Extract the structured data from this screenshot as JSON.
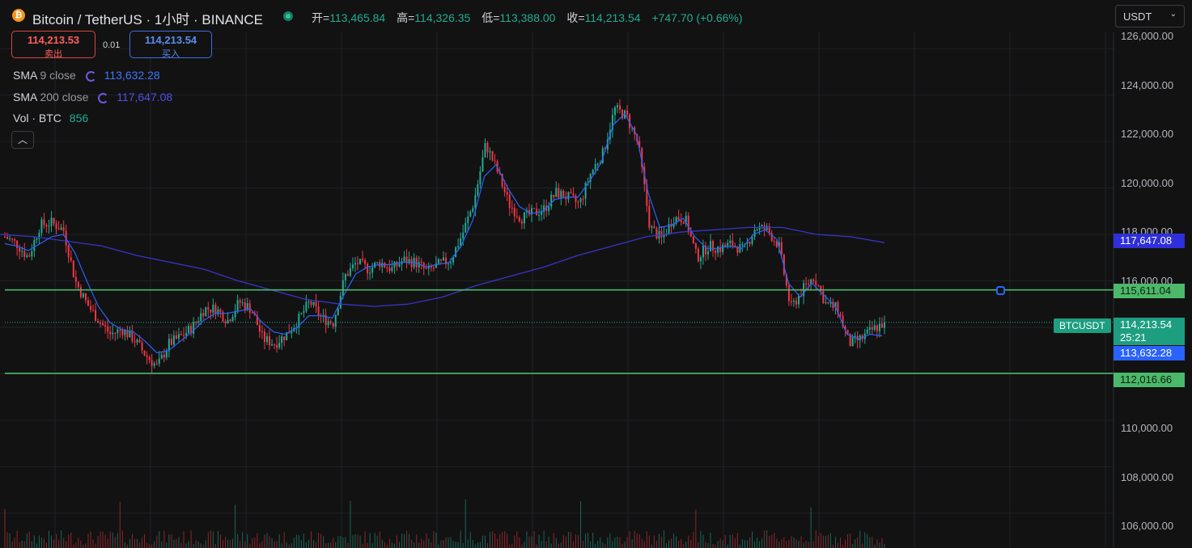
{
  "header": {
    "coin_icon": "bitcoin-icon",
    "symbol_title": "Bitcoin / TetherUS · 1小时 · BINANCE",
    "ohlc": {
      "open_label": "开=",
      "open": "113,465.84",
      "high_label": "高=",
      "high": "114,326.35",
      "low_label": "低=",
      "low": "113,388.00",
      "close_label": "收=",
      "close": "114,213.54",
      "change": "+747.70 (+0.66%)"
    }
  },
  "trade": {
    "sell_price": "114,213.53",
    "sell_label": "卖出",
    "spread": "0.01",
    "buy_price": "114,213.54",
    "buy_label": "买入"
  },
  "indicators": {
    "sma9": {
      "name": "SMA",
      "params": "9 close",
      "value": "113,632.28"
    },
    "sma200": {
      "name": "SMA",
      "params": "200 close",
      "value": "117,647.08"
    },
    "volume": {
      "name": "Vol · BTC",
      "value": "856"
    },
    "collapse_icon": "chevron-up-icon"
  },
  "currency_select": {
    "value": "USDT",
    "icon": "chevron-down-icon"
  },
  "axis": {
    "ticks": [
      "126,000.00",
      "124,000.00",
      "122,000.00",
      "120,000.00",
      "118,000.00",
      "116,000.00",
      "110,000.00",
      "108,000.00",
      "106,000.00"
    ],
    "labels": {
      "sma200": "117,647.08",
      "level1": "115,611.04",
      "last_price": "114,213.54",
      "countdown": "25:21",
      "sma9": "113,632.28",
      "level2": "112,016.66"
    },
    "symbol_tag": "BTCUSDT"
  },
  "colors": {
    "up": "#22ab94",
    "down": "#f23645",
    "sma9": "#2962ff",
    "sma200": "#3636c8",
    "level": "#4cb86a",
    "background": "#121212"
  },
  "chart_data": {
    "type": "candlestick",
    "interval": "1小时",
    "y_range": [
      104500,
      126700
    ],
    "horizontal_levels": [
      115611.04,
      112016.66
    ],
    "close_path": [
      117900,
      117600,
      117000,
      118400,
      118500,
      118200,
      116000,
      115000,
      114300,
      113700,
      113900,
      113500,
      112800,
      112300,
      113300,
      113600,
      114000,
      114800,
      114800,
      114300,
      115100,
      114800,
      113500,
      113300,
      113700,
      114300,
      115100,
      114400,
      114200,
      116200,
      116800,
      116500,
      116800,
      116500,
      116900,
      116800,
      116400,
      116700,
      116900,
      118000,
      119400,
      121900,
      120700,
      119300,
      118700,
      118900,
      119100,
      119800,
      119600,
      119300,
      120700,
      121500,
      123400,
      123100,
      121900,
      118300,
      117800,
      118700,
      118700,
      117000,
      117500,
      117400,
      117600,
      117300,
      118300,
      118200,
      117500,
      114800,
      115600,
      116200,
      115000,
      114800,
      113300,
      113500,
      113900,
      114200
    ],
    "sma9_path": [
      117600,
      117500,
      117300,
      117600,
      117900,
      118000,
      117200,
      116000,
      114900,
      114200,
      113900,
      113800,
      113400,
      112900,
      113000,
      113400,
      113800,
      114300,
      114600,
      114600,
      114700,
      114800,
      114200,
      113800,
      113700,
      114000,
      114500,
      114500,
      114400,
      115400,
      116300,
      116600,
      116700,
      116700,
      116800,
      116800,
      116600,
      116700,
      116800,
      117500,
      118600,
      120500,
      121000,
      120000,
      119200,
      118900,
      119000,
      119500,
      119600,
      119600,
      120300,
      121100,
      122700,
      123200,
      122300,
      119800,
      118300,
      118400,
      118700,
      117900,
      117400,
      117400,
      117500,
      117400,
      118000,
      118200,
      117800,
      115900,
      115300,
      115900,
      115400,
      114900,
      113700,
      113500,
      113700,
      113632.28
    ],
    "sma200_path": [
      118000,
      117900,
      117700,
      117500,
      117100,
      116800,
      116500,
      116000,
      115600,
      115200,
      115000,
      114900,
      115000,
      115300,
      115800,
      116200,
      116600,
      117100,
      117500,
      117900,
      118100,
      118200,
      118300,
      118300,
      118000,
      117900,
      117647.08
    ],
    "last_price": 114213.54,
    "volume_last": 856
  }
}
